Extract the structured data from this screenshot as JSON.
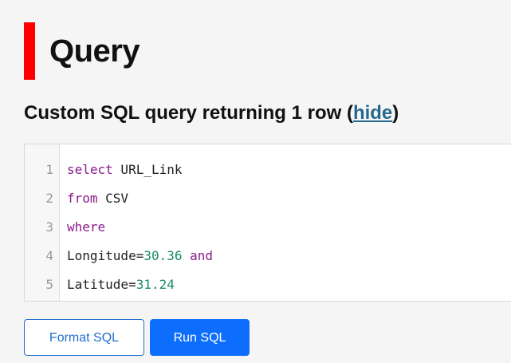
{
  "page": {
    "title": "Query",
    "accent_color": "#ff0000"
  },
  "query_header": {
    "text": "Custom SQL query returning 1 row (",
    "hide_link": "hide",
    "suffix": ")"
  },
  "editor": {
    "lines": [
      {
        "number": "1",
        "tokens": [
          {
            "t": "select",
            "k": "kw"
          },
          {
            "t": " URL_Link",
            "k": ""
          }
        ]
      },
      {
        "number": "2",
        "tokens": [
          {
            "t": "from",
            "k": "kw"
          },
          {
            "t": " CSV",
            "k": ""
          }
        ]
      },
      {
        "number": "3",
        "tokens": [
          {
            "t": "where",
            "k": "kw"
          }
        ]
      },
      {
        "number": "4",
        "tokens": [
          {
            "t": "Longitude=",
            "k": ""
          },
          {
            "t": "30.36",
            "k": "num"
          },
          {
            "t": " ",
            "k": ""
          },
          {
            "t": "and",
            "k": "kw"
          }
        ]
      },
      {
        "number": "5",
        "tokens": [
          {
            "t": "Latitude=",
            "k": ""
          },
          {
            "t": "31.24",
            "k": "num"
          }
        ]
      }
    ]
  },
  "buttons": {
    "format_label": "Format SQL",
    "run_label": "Run SQL"
  }
}
